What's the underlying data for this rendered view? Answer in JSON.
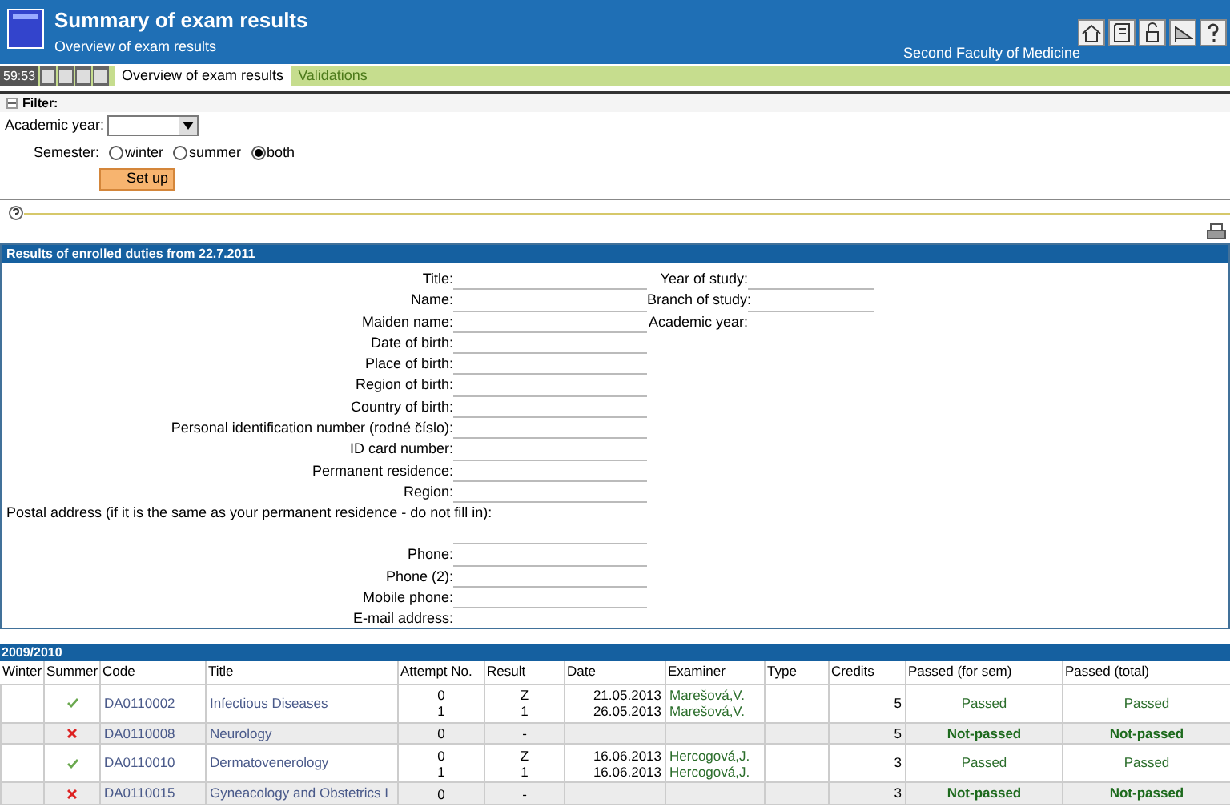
{
  "header": {
    "title": "Summary of exam results",
    "subtitle": "Overview of exam results",
    "faculty": "Second Faculty of Medicine"
  },
  "nav": {
    "timer": "59:53",
    "tabs": [
      {
        "label": "Overview of exam results",
        "selected": true
      },
      {
        "label": "Validations",
        "selected": false
      }
    ]
  },
  "filter": {
    "title": "Filter:",
    "academic_year_label": "Academic year:",
    "semester_label": "Semester:",
    "semesters": [
      {
        "label": "winter",
        "selected": false
      },
      {
        "label": "summer",
        "selected": false
      },
      {
        "label": "both",
        "selected": true
      }
    ],
    "button": "Set up"
  },
  "results": {
    "title": "Results of enrolled duties from 22.7.2011",
    "fields_left": [
      {
        "label": "Title:"
      },
      {
        "label": "Name:"
      },
      {
        "label": "Maiden name:"
      },
      {
        "label": "Date of birth:"
      },
      {
        "label": "Place of birth:"
      },
      {
        "label": "Region of birth:"
      },
      {
        "label": "Country of birth:"
      },
      {
        "label": "Personal identification number (rodné číslo):"
      },
      {
        "label": "ID card number:"
      },
      {
        "label": "Permanent residence:"
      },
      {
        "label": "Region:"
      },
      {
        "label": "Postal address (if it is the same as your permanent residence - do not fill in):",
        "kind": "tall"
      },
      {
        "label": "Phone:"
      },
      {
        "label": "Phone (2):"
      },
      {
        "label": "Mobile phone:"
      },
      {
        "label": "E-mail address:",
        "kind": "last"
      }
    ],
    "fields_right": [
      {
        "label": "Year of study:"
      },
      {
        "label": "Branch of study:"
      },
      {
        "label": "Academic year:",
        "kind": "last"
      }
    ]
  },
  "year": {
    "title": "2009/2010",
    "columns": [
      "Winter",
      "Summer",
      "Code",
      "Title",
      "Attempt No.",
      "Result",
      "Date",
      "Examiner",
      "Type",
      "Credits",
      "Passed (for sem)",
      "Passed (total)"
    ],
    "rows": [
      {
        "summer_passed": true,
        "code": "DA0110002",
        "title": "Infectious Diseases",
        "attempts": [
          "0",
          "1"
        ],
        "results": [
          "Z",
          "1"
        ],
        "dates": [
          "21.05.2013",
          "26.05.2013"
        ],
        "examiners": [
          "Marešová,V.",
          "Marešová,V."
        ],
        "credits": "5",
        "passed_sem": "Passed",
        "passed_total": "Passed",
        "passed": true
      },
      {
        "summer_passed": false,
        "code": "DA0110008",
        "title": "Neurology",
        "attempts": [
          "0"
        ],
        "results": [
          "-"
        ],
        "dates": [],
        "examiners": [],
        "credits": "5",
        "passed_sem": "Not-passed",
        "passed_total": "Not-passed",
        "passed": false
      },
      {
        "summer_passed": true,
        "code": "DA0110010",
        "title": "Dermatovenerology",
        "attempts": [
          "0",
          "1"
        ],
        "results": [
          "Z",
          "1"
        ],
        "dates": [
          "16.06.2013",
          "16.06.2013"
        ],
        "examiners": [
          "Hercogová,J.",
          "Hercogová,J."
        ],
        "credits": "3",
        "passed_sem": "Passed",
        "passed_total": "Passed",
        "passed": true
      },
      {
        "summer_passed": false,
        "code": "DA0110015",
        "title": "Gyneacology and Obstetrics I",
        "attempts": [
          "0"
        ],
        "results": [
          "-"
        ],
        "dates": [],
        "examiners": [],
        "credits": "3",
        "passed_sem": "Not-passed",
        "passed_total": "Not-passed",
        "passed": false
      }
    ]
  }
}
